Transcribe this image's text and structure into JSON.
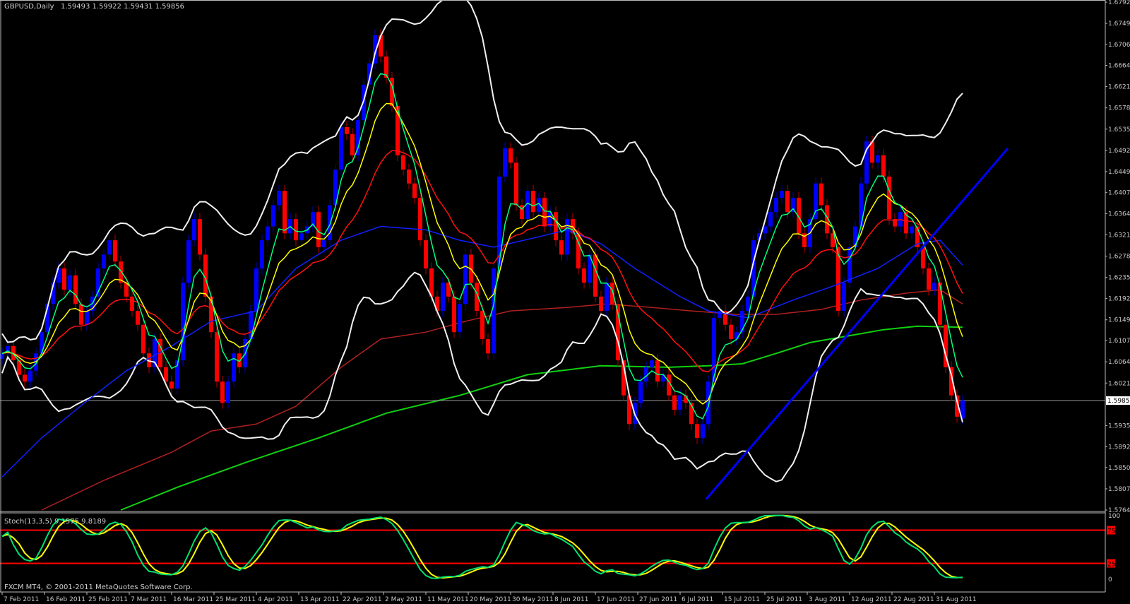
{
  "header": {
    "symbol_timeframe": "GBPUSD,Daily",
    "ohlc_text": "1.59493 1.59922 1.59431 1.59856"
  },
  "stoch_panel": {
    "label": "Stoch(13,3,5) 9.1575 9.8189",
    "copyright": "FXCM MT4, © 2001-2011 MetaQuotes Software Corp.",
    "scale_labels": [
      "100",
      "0"
    ],
    "level_labels": [
      "75",
      "25"
    ]
  },
  "colors": {
    "bull": "#0000ff",
    "bear": "#ff0000",
    "ema_fast": "#00ff80",
    "ema_mid": "#ffff00",
    "ema_slow": "#ff1010",
    "ma_blue": "#1020ff",
    "ma_darkred": "#b02020",
    "ma_green": "#10d010",
    "bands": "#f0f0f0",
    "trendline": "#0000ff",
    "stoch_main": "#00e070",
    "stoch_signal": "#ffff00",
    "levels": "#ff0000"
  },
  "chart_data": {
    "type": "candlestick",
    "title": "GBPUSD,Daily",
    "ylim": [
      1.5764,
      1.6792
    ],
    "current_price": "1.59856",
    "price_ticks": [
      "1.67920",
      "1.67490",
      "1.67060",
      "1.66640",
      "1.66210",
      "1.65780",
      "1.65350",
      "1.64920",
      "1.64490",
      "1.64070",
      "1.63640",
      "1.63210",
      "1.62780",
      "1.62350",
      "1.61920",
      "1.61490",
      "1.61070",
      "1.60640",
      "1.60210",
      "1.59350",
      "1.58920",
      "1.58500",
      "1.58070",
      "1.57640"
    ],
    "date_ticks": [
      "7 Feb 2011",
      "16 Feb 2011",
      "25 Feb 2011",
      "7 Mar 2011",
      "16 Mar 2011",
      "25 Mar 2011",
      "4 Apr 2011",
      "13 Apr 2011",
      "22 Apr 2011",
      "2 May 2011",
      "11 May 2011",
      "20 May 2011",
      "30 May 2011",
      "8 Jun 2011",
      "17 Jun 2011",
      "27 Jun 2011",
      "6 Jul 2011",
      "15 Jul 2011",
      "25 Jul 2011",
      "3 Aug 2011",
      "12 Aug 2011",
      "22 Aug 2011",
      "31 Aug 2011"
    ],
    "first_open": 1.607,
    "last_open": 1.59493,
    "wick": 0.0012,
    "close": [
      1.6081,
      1.6096,
      1.6067,
      1.6038,
      1.6024,
      1.6046,
      1.6081,
      1.6124,
      1.6181,
      1.6224,
      1.6253,
      1.621,
      1.6239,
      1.6181,
      1.6139,
      1.6167,
      1.6196,
      1.6253,
      1.6281,
      1.631,
      1.6267,
      1.6224,
      1.6196,
      1.6167,
      1.6139,
      1.6081,
      1.6053,
      1.611,
      1.6053,
      1.6024,
      1.601,
      1.6067,
      1.6224,
      1.631,
      1.6353,
      1.6281,
      1.6196,
      1.6124,
      1.6024,
      1.5981,
      1.6024,
      1.6081,
      1.6053,
      1.611,
      1.6167,
      1.6253,
      1.631,
      1.6338,
      1.6381,
      1.641,
      1.6324,
      1.6353,
      1.631,
      1.6324,
      1.6338,
      1.6367,
      1.6296,
      1.631,
      1.6381,
      1.6453,
      1.6539,
      1.6525,
      1.6482,
      1.6553,
      1.6625,
      1.6668,
      1.6725,
      1.6682,
      1.6639,
      1.6582,
      1.6482,
      1.6453,
      1.6425,
      1.6396,
      1.631,
      1.6253,
      1.6196,
      1.6167,
      1.6224,
      1.6196,
      1.6124,
      1.6181,
      1.6281,
      1.6224,
      1.6167,
      1.611,
      1.6081,
      1.6253,
      1.6439,
      1.6496,
      1.6467,
      1.6381,
      1.6353,
      1.641,
      1.6367,
      1.6396,
      1.6338,
      1.6367,
      1.631,
      1.6281,
      1.6353,
      1.6324,
      1.6253,
      1.6224,
      1.6281,
      1.6196,
      1.6167,
      1.6224,
      1.6181,
      1.6067,
      1.5996,
      1.5938,
      1.5981,
      1.6024,
      1.6053,
      1.6067,
      1.6024,
      1.6038,
      1.5996,
      1.5967,
      1.5996,
      1.5981,
      1.5938,
      1.591,
      1.5938,
      1.6024,
      1.6153,
      1.6167,
      1.6139,
      1.611,
      1.6124,
      1.6167,
      1.6196,
      1.631,
      1.6324,
      1.6338,
      1.6367,
      1.6396,
      1.641,
      1.6367,
      1.6396,
      1.6324,
      1.6296,
      1.6353,
      1.6425,
      1.6381,
      1.6324,
      1.6296,
      1.6167,
      1.6224,
      1.6296,
      1.6338,
      1.6425,
      1.651,
      1.6467,
      1.6482,
      1.6439,
      1.6353,
      1.6338,
      1.6367,
      1.6324,
      1.6338,
      1.6296,
      1.6253,
      1.621,
      1.6224,
      1.6139,
      1.6053,
      1.5996,
      1.5953,
      1.59856
    ],
    "ema_periods": {
      "fast": 5,
      "mid": 10,
      "slow": 21
    },
    "bollinger": {
      "period": 20,
      "deviations": 2
    },
    "stochastic": {
      "k": 13,
      "d": 3,
      "slowing": 5,
      "levels": [
        75,
        25
      ],
      "range": [
        0,
        100
      ]
    },
    "ma_blue": [
      [
        0,
        1.5831
      ],
      [
        7,
        1.591
      ],
      [
        14.6,
        1.5981
      ],
      [
        22,
        1.6046
      ],
      [
        30,
        1.6096
      ],
      [
        37,
        1.6146
      ],
      [
        45,
        1.6167
      ],
      [
        52,
        1.6253
      ],
      [
        60,
        1.631
      ],
      [
        67,
        1.6338
      ],
      [
        75,
        1.6331
      ],
      [
        81,
        1.631
      ],
      [
        87,
        1.6296
      ],
      [
        95,
        1.6317
      ],
      [
        100,
        1.6331
      ],
      [
        106,
        1.6303
      ],
      [
        112,
        1.6253
      ],
      [
        120,
        1.6196
      ],
      [
        125,
        1.6167
      ],
      [
        132,
        1.6153
      ],
      [
        140,
        1.6189
      ],
      [
        147,
        1.6217
      ],
      [
        155,
        1.6253
      ],
      [
        162,
        1.6303
      ],
      [
        166,
        1.631
      ],
      [
        170,
        1.626
      ]
    ],
    "ma_darkred": [
      [
        7,
        1.5764
      ],
      [
        18,
        1.5824
      ],
      [
        30,
        1.5881
      ],
      [
        37,
        1.5924
      ],
      [
        45,
        1.5938
      ],
      [
        52,
        1.5974
      ],
      [
        60,
        1.6053
      ],
      [
        67,
        1.611
      ],
      [
        75,
        1.6124
      ],
      [
        82,
        1.6146
      ],
      [
        90,
        1.6167
      ],
      [
        100,
        1.6174
      ],
      [
        107,
        1.6181
      ],
      [
        115,
        1.6174
      ],
      [
        122,
        1.6167
      ],
      [
        130,
        1.616
      ],
      [
        137,
        1.616
      ],
      [
        145,
        1.617
      ],
      [
        152,
        1.6189
      ],
      [
        160,
        1.6203
      ],
      [
        166,
        1.621
      ],
      [
        170,
        1.6181
      ]
    ],
    "ma_green": [
      [
        21,
        1.5764
      ],
      [
        31,
        1.581
      ],
      [
        43,
        1.586
      ],
      [
        56,
        1.591
      ],
      [
        68,
        1.596
      ],
      [
        81,
        1.5996
      ],
      [
        93,
        1.6038
      ],
      [
        106,
        1.6056
      ],
      [
        118,
        1.6053
      ],
      [
        125,
        1.6056
      ],
      [
        131,
        1.606
      ],
      [
        137,
        1.6081
      ],
      [
        143,
        1.6103
      ],
      [
        150,
        1.6117
      ],
      [
        156,
        1.6129
      ],
      [
        162,
        1.6136
      ],
      [
        170,
        1.6134
      ]
    ],
    "trendline": [
      [
        124.6,
        1.5786
      ],
      [
        178,
        1.6496
      ]
    ]
  }
}
